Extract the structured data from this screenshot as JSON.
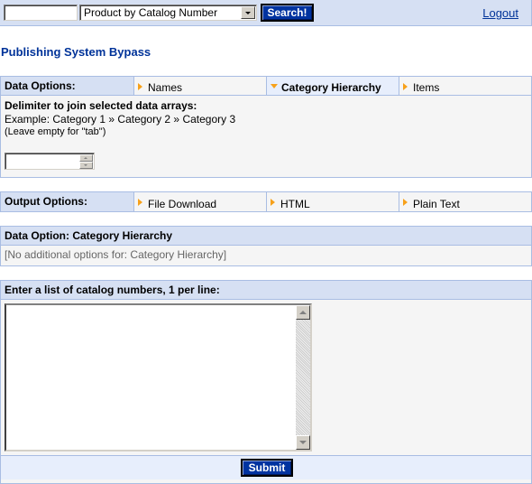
{
  "topbar": {
    "search_value": "",
    "search_type_selected": "Product by Catalog Number",
    "search_button": "Search!",
    "logout_label": "Logout"
  },
  "page_title": "Publishing System Bypass",
  "data_options": {
    "label": "Data Options:",
    "items": [
      {
        "label": "Names",
        "active": false
      },
      {
        "label": "Category Hierarchy",
        "active": true
      },
      {
        "label": "Items",
        "active": false
      }
    ],
    "delimiter": {
      "title": "Delimiter to join selected data arrays:",
      "example": "Example: Category 1 » Category 2 » Category 3",
      "note": "(Leave empty for \"tab\")",
      "value": ""
    }
  },
  "output_options": {
    "label": "Output Options:",
    "items": [
      {
        "label": "File Download"
      },
      {
        "label": "HTML"
      },
      {
        "label": "Plain Text"
      }
    ]
  },
  "data_option_detail": {
    "header": "Data Option: Category Hierarchy",
    "text": "[No additional options for: Category Hierarchy]"
  },
  "catalog_entry": {
    "header": "Enter a list of catalog numbers, 1 per line:",
    "value": "",
    "submit_label": "Submit"
  },
  "colors": {
    "header_bg": "#d6e0f3",
    "border": "#a9bde3",
    "title": "#003399",
    "button": "#0033a0",
    "arrow": "#f7a11a"
  }
}
